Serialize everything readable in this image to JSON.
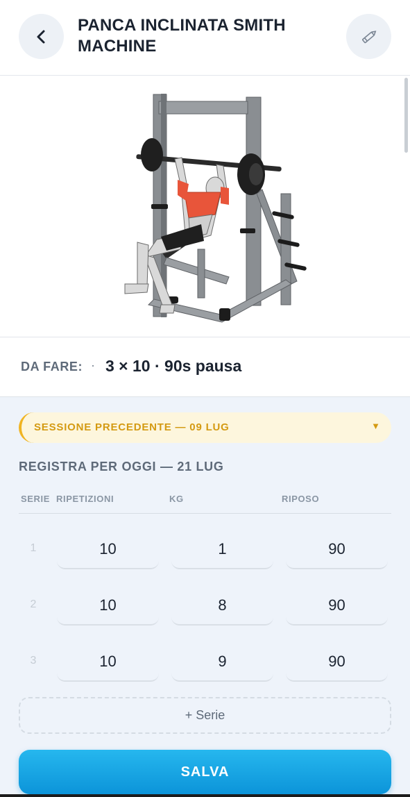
{
  "header": {
    "title": "PANCA INCLINATA SMITH MACHINE",
    "back_icon": "chevron-left-icon",
    "edit_icon": "pencil-icon"
  },
  "illustration": {
    "alt": "incline-bench-smith-machine-illustration"
  },
  "todo": {
    "label": "DA FARE:",
    "separator": "·",
    "value": "3 × 10 · 90s pausa"
  },
  "previous_session": {
    "label": "SESSIONE PRECEDENTE — 09 LUG",
    "caret": "▼"
  },
  "log": {
    "title": "REGISTRA PER OGGI — 21 LUG",
    "columns": [
      "SERIE",
      "RIPETIZIONI",
      "KG",
      "RIPOSO"
    ],
    "rows": [
      {
        "set": "1",
        "reps": "10",
        "kg": "1",
        "rest": "90"
      },
      {
        "set": "2",
        "reps": "10",
        "kg": "8",
        "rest": "90"
      },
      {
        "set": "3",
        "reps": "10",
        "kg": "9",
        "rest": "90"
      }
    ]
  },
  "add_set_label": "+ Serie",
  "save_label": "SALVA",
  "colors": {
    "accent": "#0c94d9",
    "warning": "#f0b422",
    "muscle": "#e8553a"
  }
}
